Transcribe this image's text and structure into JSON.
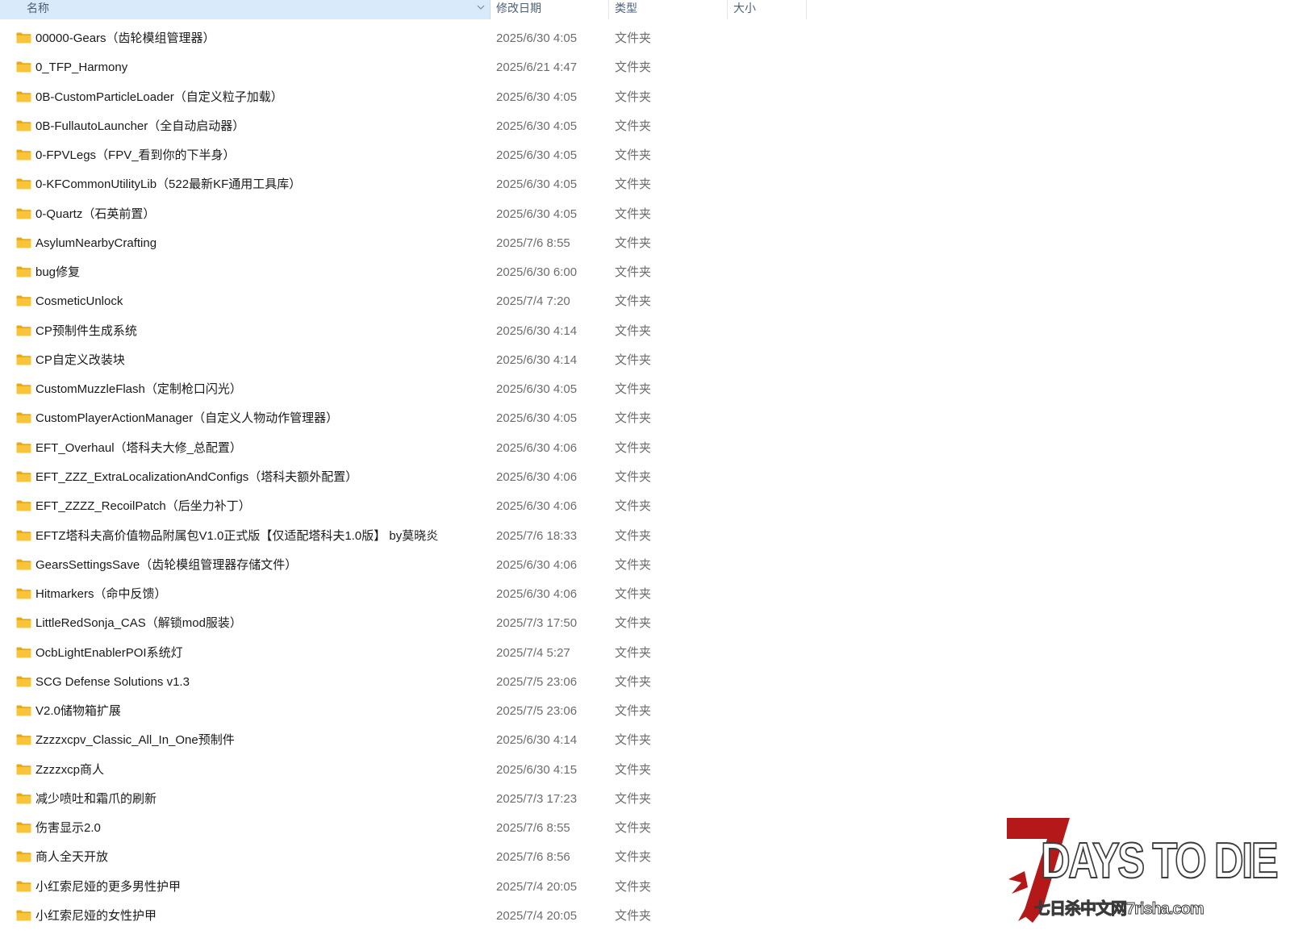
{
  "columns": {
    "name": "名称",
    "date": "修改日期",
    "type": "类型",
    "size": "大小"
  },
  "colors": {
    "header_bg": "#d9eafb",
    "folder_yellow": "#f8c53a",
    "text_secondary": "#6d6d6d"
  },
  "rows": [
    {
      "name": "00000-Gears（齿轮模组管理器）",
      "date": "2025/6/30 4:05",
      "type": "文件夹"
    },
    {
      "name": "0_TFP_Harmony",
      "date": "2025/6/21 4:47",
      "type": "文件夹"
    },
    {
      "name": "0B-CustomParticleLoader（自定义粒子加载）",
      "date": "2025/6/30 4:05",
      "type": "文件夹"
    },
    {
      "name": "0B-FullautoLauncher（全自动启动器）",
      "date": "2025/6/30 4:05",
      "type": "文件夹"
    },
    {
      "name": "0-FPVLegs（FPV_看到你的下半身）",
      "date": "2025/6/30 4:05",
      "type": "文件夹"
    },
    {
      "name": "0-KFCommonUtilityLib（522最新KF通用工具库）",
      "date": "2025/6/30 4:05",
      "type": "文件夹"
    },
    {
      "name": "0-Quartz（石英前置）",
      "date": "2025/6/30 4:05",
      "type": "文件夹"
    },
    {
      "name": "AsylumNearbyCrafting",
      "date": "2025/7/6 8:55",
      "type": "文件夹"
    },
    {
      "name": "bug修复",
      "date": "2025/6/30 6:00",
      "type": "文件夹"
    },
    {
      "name": "CosmeticUnlock",
      "date": "2025/7/4 7:20",
      "type": "文件夹"
    },
    {
      "name": "CP预制件生成系统",
      "date": "2025/6/30 4:14",
      "type": "文件夹"
    },
    {
      "name": "CP自定义改装块",
      "date": "2025/6/30 4:14",
      "type": "文件夹"
    },
    {
      "name": "CustomMuzzleFlash（定制枪口闪光）",
      "date": "2025/6/30 4:05",
      "type": "文件夹"
    },
    {
      "name": "CustomPlayerActionManager（自定义人物动作管理器）",
      "date": "2025/6/30 4:05",
      "type": "文件夹"
    },
    {
      "name": "EFT_Overhaul（塔科夫大修_总配置）",
      "date": "2025/6/30 4:06",
      "type": "文件夹"
    },
    {
      "name": "EFT_ZZZ_ExtraLocalizationAndConfigs（塔科夫额外配置）",
      "date": "2025/6/30 4:06",
      "type": "文件夹"
    },
    {
      "name": "EFT_ZZZZ_RecoilPatch（后坐力补丁）",
      "date": "2025/6/30 4:06",
      "type": "文件夹"
    },
    {
      "name": "EFTZ塔科夫高价值物品附属包V1.0正式版【仅适配塔科夫1.0版】 by莫晓炎",
      "date": "2025/7/6 18:33",
      "type": "文件夹"
    },
    {
      "name": "GearsSettingsSave（齿轮模组管理器存储文件）",
      "date": "2025/6/30 4:06",
      "type": "文件夹"
    },
    {
      "name": "Hitmarkers（命中反馈）",
      "date": "2025/6/30 4:06",
      "type": "文件夹"
    },
    {
      "name": "LittleRedSonja_CAS（解锁mod服装）",
      "date": "2025/7/3 17:50",
      "type": "文件夹"
    },
    {
      "name": "OcbLightEnablerPOI系统灯",
      "date": "2025/7/4 5:27",
      "type": "文件夹"
    },
    {
      "name": "SCG Defense Solutions v1.3",
      "date": "2025/7/5 23:06",
      "type": "文件夹"
    },
    {
      "name": "V2.0储物箱扩展",
      "date": "2025/7/5 23:06",
      "type": "文件夹"
    },
    {
      "name": "Zzzzxcpv_Classic_All_In_One预制件",
      "date": "2025/6/30 4:14",
      "type": "文件夹"
    },
    {
      "name": "Zzzzxcp商人",
      "date": "2025/6/30 4:15",
      "type": "文件夹"
    },
    {
      "name": "减少喷吐和霜爪的刷新",
      "date": "2025/7/3 17:23",
      "type": "文件夹"
    },
    {
      "name": "伤害显示2.0",
      "date": "2025/7/6 8:55",
      "type": "文件夹"
    },
    {
      "name": "商人全天开放",
      "date": "2025/7/6 8:56",
      "type": "文件夹"
    },
    {
      "name": "小红索尼娅的更多男性护甲",
      "date": "2025/7/4 20:05",
      "type": "文件夹"
    },
    {
      "name": "小红索尼娅的女性护甲",
      "date": "2025/7/4 20:05",
      "type": "文件夹"
    }
  ],
  "watermark": {
    "wordmark": "DAYS TO DIE",
    "tagline": "七日杀中文网7risha.com"
  }
}
